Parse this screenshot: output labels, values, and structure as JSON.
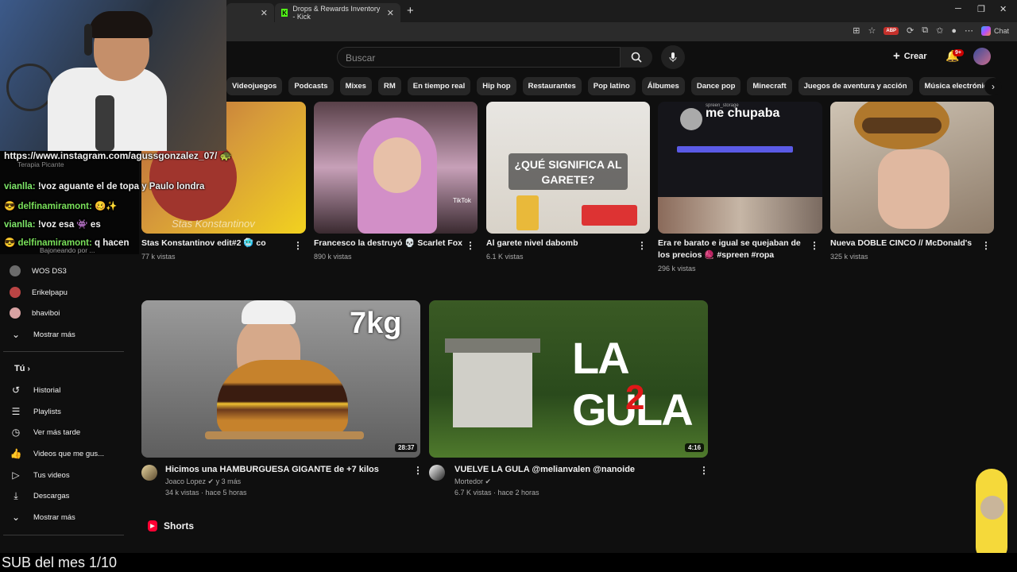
{
  "browser": {
    "tab2_title": "Drops & Rewards Inventory - Kick",
    "chat_label": "Chat",
    "abp_label": "ABP",
    "new_tab_label": "+",
    "close_glyph": "✕",
    "min_glyph": "─",
    "max_glyph": "❐"
  },
  "header": {
    "search_placeholder": "Buscar",
    "create_label": "Crear",
    "notif_badge": "9+"
  },
  "chips": [
    "Videojuegos",
    "Podcasts",
    "Mixes",
    "RM",
    "En tiempo real",
    "Hip hop",
    "Restaurantes",
    "Pop latino",
    "Álbumes",
    "Dance pop",
    "Minecraft",
    "Juegos de aventura y acción",
    "Música electrónica"
  ],
  "sidebar": {
    "subs": [
      {
        "label": "Terapia Picante"
      },
      {
        "label": "Bajoneando por ..."
      },
      {
        "label": "WOS DS3"
      },
      {
        "label": "Erikelpapu"
      },
      {
        "label": "bhaviboi"
      }
    ],
    "show_more": "Mostrar más",
    "you_label": "Tú",
    "you_items": [
      {
        "label": "Historial",
        "icon": "history-icon"
      },
      {
        "label": "Playlists",
        "icon": "playlist-icon"
      },
      {
        "label": "Ver más tarde",
        "icon": "clock-icon"
      },
      {
        "label": "Videos que me gus...",
        "icon": "thumbs-up-icon"
      },
      {
        "label": "Tus videos",
        "icon": "video-icon"
      },
      {
        "label": "Descargas",
        "icon": "download-icon"
      }
    ],
    "show_more_2": "Mostrar más"
  },
  "row1": [
    {
      "title": "Stas Konstantinov edit#2 🥶 co",
      "meta": "77 k vistas",
      "overlay": "Stas Konstantinov"
    },
    {
      "title": "Francesco la destruyó 💀 Scarlet Fox",
      "meta": "890 k vistas",
      "overlay": "TikTok"
    },
    {
      "title": "Al garete nivel dabomb",
      "meta": "6.1 K vistas",
      "overlay": "¿QUÉ SIGNIFICA AL GARETE?"
    },
    {
      "title_line1": "Era re barato e igual se quejaban de",
      "title_line2": "los precios 🧶 #spreen #ropa",
      "meta": "296 k vistas",
      "overlay": "me chupaba",
      "overlay_small": "spreen_storage"
    },
    {
      "title": "Nueva DOBLE CINCO // McDonald's",
      "meta": "325 k vistas"
    }
  ],
  "row2": [
    {
      "title": "Hicimos una HAMBURGUESA GIGANTE de +7 kilos",
      "channel": "Joaco Lopez ✔ y 3 más",
      "meta": "34 k vistas · hace 5 horas",
      "duration": "28:37",
      "overlay": "7kg"
    },
    {
      "title": "VUELVE LA GULA @melianvalen @nanoide",
      "channel": "Mortedor ✔",
      "meta": "6.7 K vistas · hace 2 horas",
      "duration": "4:16",
      "overlay_line1": "LA GULA",
      "overlay_line2": "2"
    }
  ],
  "shorts_label": "Shorts",
  "overlay_chat": {
    "link": "https://www.instagram.com/agussgonzalez_07/ 🐢",
    "messages": [
      {
        "user": "vianlla:",
        "text": "!voz aguante el de topa y Paulo londra"
      },
      {
        "user": "delfinamiramont:",
        "text": "🥴✨"
      },
      {
        "user": "vianlla:",
        "text": "!voz esa 👾 es"
      },
      {
        "user": "delfinamiramont:",
        "text": "q hacen"
      }
    ]
  },
  "sub_banner": "SUB del mes 1/10"
}
